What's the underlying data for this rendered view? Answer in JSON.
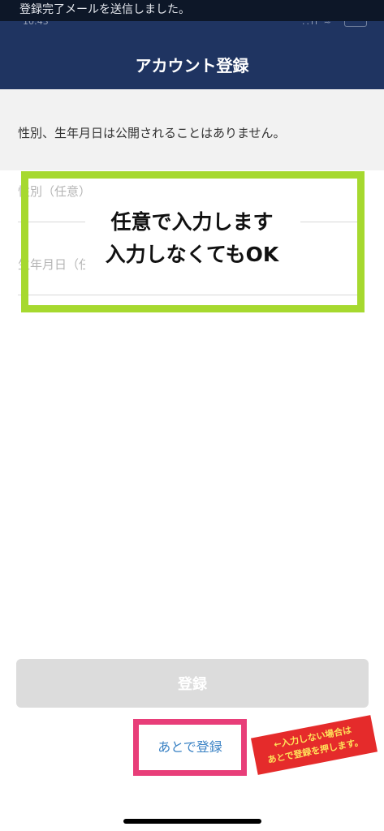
{
  "toast": {
    "text": "登録完了メールを送信しました。"
  },
  "status_bar": {
    "time_fragment": "10:43",
    "icons_fragment": "..ıl ≈"
  },
  "header": {
    "title": "アカウント登録"
  },
  "notice": {
    "text": "性別、生年月日は公開されることはありません。"
  },
  "form": {
    "gender_label": "性別（任意）",
    "birthdate_label": "生年月日（任意）"
  },
  "annotation": {
    "line1": "任意で入力します",
    "line2": "入力しなくてもOK",
    "callout_line1": "←入力しない場合は",
    "callout_line2": "あとで登録を押します。"
  },
  "actions": {
    "register_label": "登録",
    "later_label": "あとで登録"
  },
  "colors": {
    "header_bg": "#1f3461",
    "highlight_green": "#a6d92f",
    "highlight_pink": "#e83e79",
    "callout_red": "#e52b2b",
    "link_blue": "#3a82c4",
    "disabled_button": "#dcdcdc"
  }
}
